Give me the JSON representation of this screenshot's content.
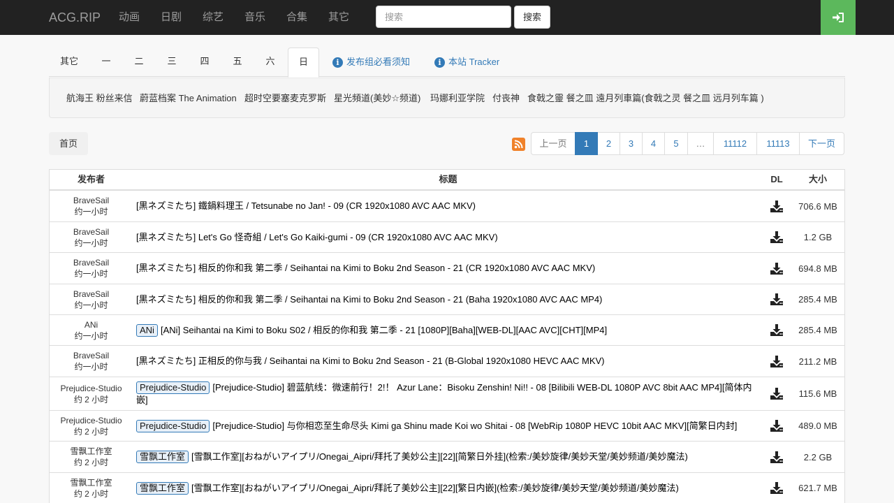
{
  "navbar": {
    "brand": "ACG.RIP",
    "items": [
      "动画",
      "日剧",
      "综艺",
      "音乐",
      "合集",
      "其它"
    ],
    "search_placeholder": "搜索",
    "search_button": "搜索",
    "login_icon": "sign-in-icon"
  },
  "tabs": {
    "items": [
      "其它",
      "一",
      "二",
      "三",
      "四",
      "五",
      "六",
      "日"
    ],
    "active": "日",
    "links": [
      "发布组必看须知",
      "本站 Tracker"
    ]
  },
  "series": [
    "航海王 粉丝来信",
    "蔚蓝档案 The Animation",
    "超时空要塞麦克罗斯",
    "星光頻道(美妙☆频道)",
    "玛娜利亚学院",
    "付丧神",
    "食戟之靈 餐之皿 遠月列車篇(食戟之灵 餐之皿 远月列车篇 )"
  ],
  "breadcrumb": "首页",
  "pagination": {
    "prev": "上一页",
    "pages": [
      "1",
      "2",
      "3",
      "4",
      "5",
      "…",
      "11112",
      "11113"
    ],
    "active_page": "1",
    "next": "下一页"
  },
  "table": {
    "headers": {
      "publisher": "发布者",
      "title": "标题",
      "dl": "DL",
      "size": "大小"
    },
    "rows": [
      {
        "publisher": "BraveSail",
        "time": "约一小时",
        "label": "",
        "title": "[黒ネズミたち] 鐵鍋料理王 / Tetsunabe no Jan! - 09 (CR 1920x1080 AVC AAC MKV)",
        "size": "706.6 MB"
      },
      {
        "publisher": "BraveSail",
        "time": "约一小时",
        "label": "",
        "title": "[黒ネズミたち] Let's Go 怪奇組 / Let's Go Kaiki-gumi - 09 (CR 1920x1080 AVC AAC MKV)",
        "size": "1.2 GB"
      },
      {
        "publisher": "BraveSail",
        "time": "约一小时",
        "label": "",
        "title": "[黒ネズミたち] 相反的你和我 第二季 / Seihantai na Kimi to Boku 2nd Season - 21 (CR 1920x1080 AVC AAC MKV)",
        "size": "694.8 MB"
      },
      {
        "publisher": "BraveSail",
        "time": "约一小时",
        "label": "",
        "title": "[黒ネズミたち] 相反的你和我 第二季 / Seihantai na Kimi to Boku 2nd Season - 21 (Baha 1920x1080 AVC AAC MP4)",
        "size": "285.4 MB"
      },
      {
        "publisher": "ANi",
        "time": "约一小时",
        "label": "ANi",
        "title": "[ANi] Seihantai na Kimi to Boku S02 / 相反的你和我 第二季 - 21 [1080P][Baha][WEB-DL][AAC AVC][CHT][MP4]",
        "size": "285.4 MB"
      },
      {
        "publisher": "BraveSail",
        "time": "约一小时",
        "label": "",
        "title": "[黒ネズミたち] 正相反的你与我 / Seihantai na Kimi to Boku 2nd Season - 21 (B-Global 1920x1080 HEVC AAC MKV)",
        "size": "211.2 MB"
      },
      {
        "publisher": "Prejudice-Studio",
        "time": "约 2 小时",
        "label": "Prejudice-Studio",
        "title": "[Prejudice-Studio] 碧蓝航线：微速前行！2!！ Azur Lane：Bisoku Zenshin! Ni!! - 08 [Bilibili WEB-DL 1080P AVC 8bit AAC MP4][简体内嵌]",
        "size": "115.6 MB"
      },
      {
        "publisher": "Prejudice-Studio",
        "time": "约 2 小时",
        "label": "Prejudice-Studio",
        "title": "[Prejudice-Studio] 与你相恋至生命尽头 Kimi ga Shinu made Koi wo Shitai - 08 [WebRip 1080P HEVC 10bit AAC MKV][简繁日内封]",
        "size": "489.0 MB"
      },
      {
        "publisher": "雪飘工作室",
        "time": "约 2 小时",
        "label": "雪飘工作室",
        "title": "[雪飘工作室][おねがいアイプリ/Onegai_Aipri/拜托了美妙公主][22][简繁日外挂](检索:/美妙旋律/美妙天堂/美妙频道/美妙魔法)",
        "size": "2.2 GB"
      },
      {
        "publisher": "雪飘工作室",
        "time": "约 2 小时",
        "label": "雪飘工作室",
        "title": "[雪飘工作室][おねがいアイプリ/Onegai_Aipri/拜託了美妙公主][22][繁日内嵌](检索:/美妙旋律/美妙天堂/美妙频道/美妙魔法)",
        "size": "621.7 MB"
      }
    ]
  },
  "colors": {
    "navbar_bg": "#222222",
    "login_bg": "#5cb85c",
    "link": "#337ab7",
    "rss": "#f0822a"
  }
}
